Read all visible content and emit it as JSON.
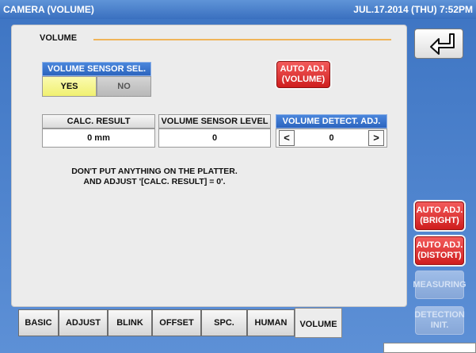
{
  "titlebar": {
    "title": "CAMERA (VOLUME)",
    "datetime": "JUL.17.2014 (THU)  7:52PM"
  },
  "section": {
    "title": "VOLUME"
  },
  "sensor_select": {
    "header": "VOLUME SENSOR SEL.",
    "yes": "YES",
    "no": "NO",
    "selected": "YES"
  },
  "auto_adj_volume": {
    "label_line1": "AUTO ADJ.",
    "label_line2": "(VOLUME)"
  },
  "calc_result": {
    "header": "CALC. RESULT",
    "value": "0 mm"
  },
  "sensor_level": {
    "header": "VOLUME SENSOR LEVEL",
    "value": "0"
  },
  "detect_adj": {
    "header": "VOLUME DETECT. ADJ.",
    "value": "0",
    "dec": "<",
    "inc": ">"
  },
  "note": {
    "line1": "DON'T PUT ANYTHING ON THE PLATTER.",
    "line2": "AND ADJUST '[CALC. RESULT] = 0'."
  },
  "tabs": [
    {
      "label": "BASIC"
    },
    {
      "label": "ADJUST"
    },
    {
      "label": "BLINK"
    },
    {
      "label": "OFFSET"
    },
    {
      "label": "SPC."
    },
    {
      "label": "HUMAN"
    },
    {
      "label": "VOLUME",
      "active": true
    }
  ],
  "side": {
    "back_icon": "return-arrow-icon",
    "auto_bright": {
      "line1": "AUTO ADJ.",
      "line2": "(BRIGHT)"
    },
    "auto_distort": {
      "line1": "AUTO ADJ.",
      "line2": "(DISTORT)"
    },
    "measuring": "MEASURING",
    "detection_init": {
      "line1": "DETECTION",
      "line2": "INIT."
    }
  },
  "colors": {
    "accent_blue": "#3a70c0",
    "alert_red": "#cf1e1e",
    "select_yellow": "#f0f070"
  }
}
